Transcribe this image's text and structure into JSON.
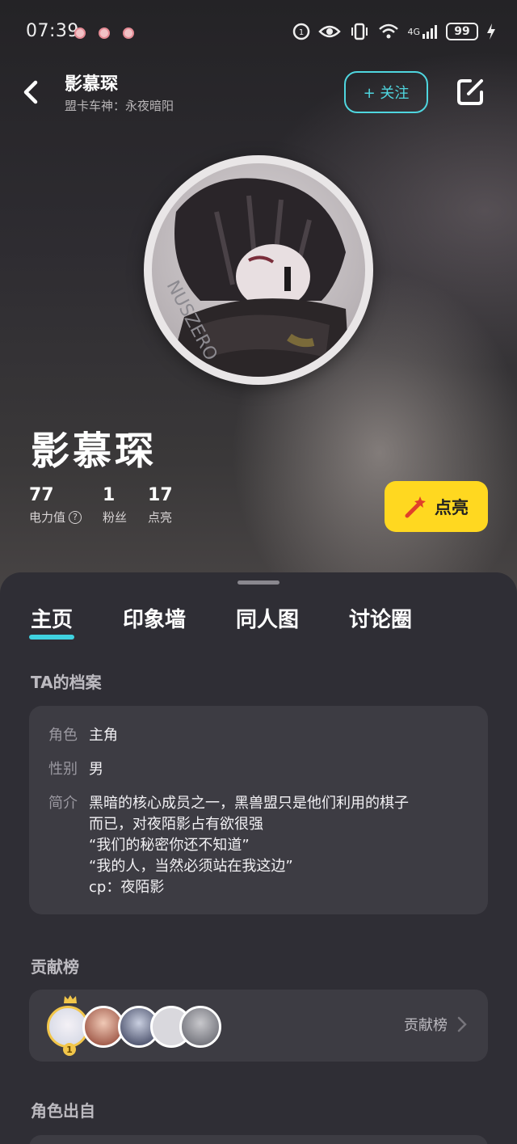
{
  "status_bar": {
    "time": "07:39",
    "battery": "99",
    "network": "4G"
  },
  "header": {
    "name": "影慕琛",
    "subtitle": "盟卡车神：永夜暗阳",
    "follow_label": "+ 关注"
  },
  "profile": {
    "display_name": "影慕琛",
    "stats": [
      {
        "value": "77",
        "label": "电力值"
      },
      {
        "value": "1",
        "label": "粉丝"
      },
      {
        "value": "17",
        "label": "点亮"
      }
    ],
    "light_button_label": "点亮"
  },
  "tabs": [
    "主页",
    "印象墙",
    "同人图",
    "讨论圈"
  ],
  "archive": {
    "title": "TA的档案",
    "role_key": "角色",
    "role_value": "主角",
    "gender_key": "性别",
    "gender_value": "男",
    "intro_key": "简介",
    "intro_lines": [
      "黑暗的核心成员之一，黑兽盟只是他们利用的棋子",
      "而已，对夜陌影占有欲很强",
      "“我们的秘密你还不知道”",
      "“我的人，当然必须站在我这边”",
      "cp：夜陌影"
    ]
  },
  "contribution": {
    "title": "贡献榜",
    "link_label": "贡献榜",
    "rank_first": "1"
  },
  "origin": {
    "title": "角色出自"
  },
  "colors": {
    "accent": "#3fd2e0",
    "light_button": "#ffd820",
    "sheet_bg": "#2f2e35",
    "card_bg": "#3d3c43"
  }
}
